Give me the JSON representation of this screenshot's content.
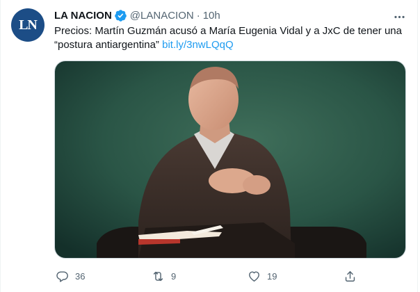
{
  "account": {
    "avatar_text": "LN",
    "display_name": "LA NACION",
    "handle": "@LANACION",
    "separator": "·",
    "time": "10h"
  },
  "tweet": {
    "text": "Precios: Martín Guzmán acusó a María Eugenia Vidal y a JxC de tener una “postura antiargentina”",
    "link": "bit.ly/3nwLQqQ"
  },
  "actions": {
    "reply_count": "36",
    "retweet_count": "9",
    "like_count": "19"
  },
  "icons": {
    "verified": "verified-badge-icon",
    "more": "more-options-icon",
    "reply": "reply-icon",
    "retweet": "retweet-icon",
    "like": "like-icon",
    "share": "share-icon"
  },
  "colors": {
    "link": "#1d9bf0",
    "secondary_text": "#536471",
    "avatar_bg": "#1c4d86",
    "verified": "#1d9bf0"
  }
}
